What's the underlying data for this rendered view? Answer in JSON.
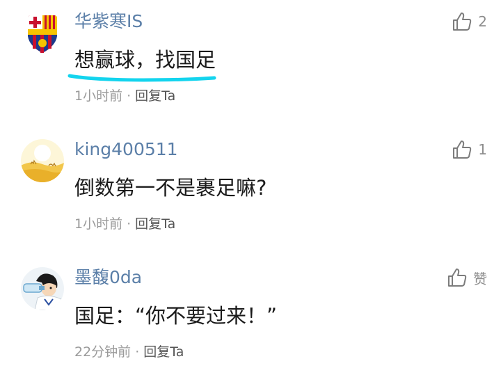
{
  "comments": [
    {
      "username": "华紫寒IS",
      "content": "想赢球，找国足",
      "time": "1小时前",
      "separator": "·",
      "reply_label": "回复Ta",
      "like_count": "2",
      "avatar_icon": "fc-barcelona-crest-icon"
    },
    {
      "username": "king400511",
      "content": "倒数第一不是裹足嘛?",
      "time": "1小时前",
      "separator": "·",
      "reply_label": "回复Ta",
      "like_count": "1",
      "avatar_icon": "desert-camel-avatar-icon"
    },
    {
      "username": "墨馥0da",
      "content": "国足：“你不要过来！”",
      "time": "22分钟前",
      "separator": "·",
      "reply_label": "回复Ta",
      "like_count": "赞",
      "avatar_icon": "cartoon-boy-avatar-icon"
    }
  ],
  "colors": {
    "username": "#5b7fa8",
    "content": "#1a1a1a",
    "meta": "#9a9a9a",
    "highlight_underline": "#13d4ee"
  }
}
